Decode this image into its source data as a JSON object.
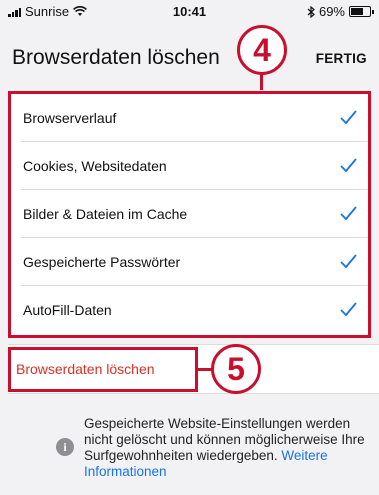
{
  "status_bar": {
    "carrier": "Sunrise",
    "time": "10:41",
    "battery": "69%",
    "battery_level": 0.69,
    "bluetooth_icon": "bluetooth-icon",
    "wifi_icon": "wifi-icon"
  },
  "header": {
    "title": "Browserdaten löschen",
    "done_label": "FERTIG"
  },
  "callouts": {
    "badge_4": "4",
    "badge_5": "5",
    "color": "#c8102e"
  },
  "options": [
    {
      "label": "Browserverlauf",
      "checked": true
    },
    {
      "label": "Cookies, Websitedaten",
      "checked": true
    },
    {
      "label": "Bilder & Dateien im Cache",
      "checked": true
    },
    {
      "label": "Gespeicherte Passwörter",
      "checked": true
    },
    {
      "label": "AutoFill-Daten",
      "checked": true
    }
  ],
  "clear_button": {
    "label": "Browserdaten löschen",
    "color": "#d93025"
  },
  "footer": {
    "icon": "info-icon",
    "text": "Gespeicherte Website-Einstellungen werden nicht gelöscht und können möglicherweise Ihre Surfgewohnheiten wiedergeben.",
    "link": "Weitere Informationen",
    "link_color": "#1a73e8"
  },
  "colors": {
    "check": "#1a73e8",
    "background": "#f2f2f4"
  }
}
